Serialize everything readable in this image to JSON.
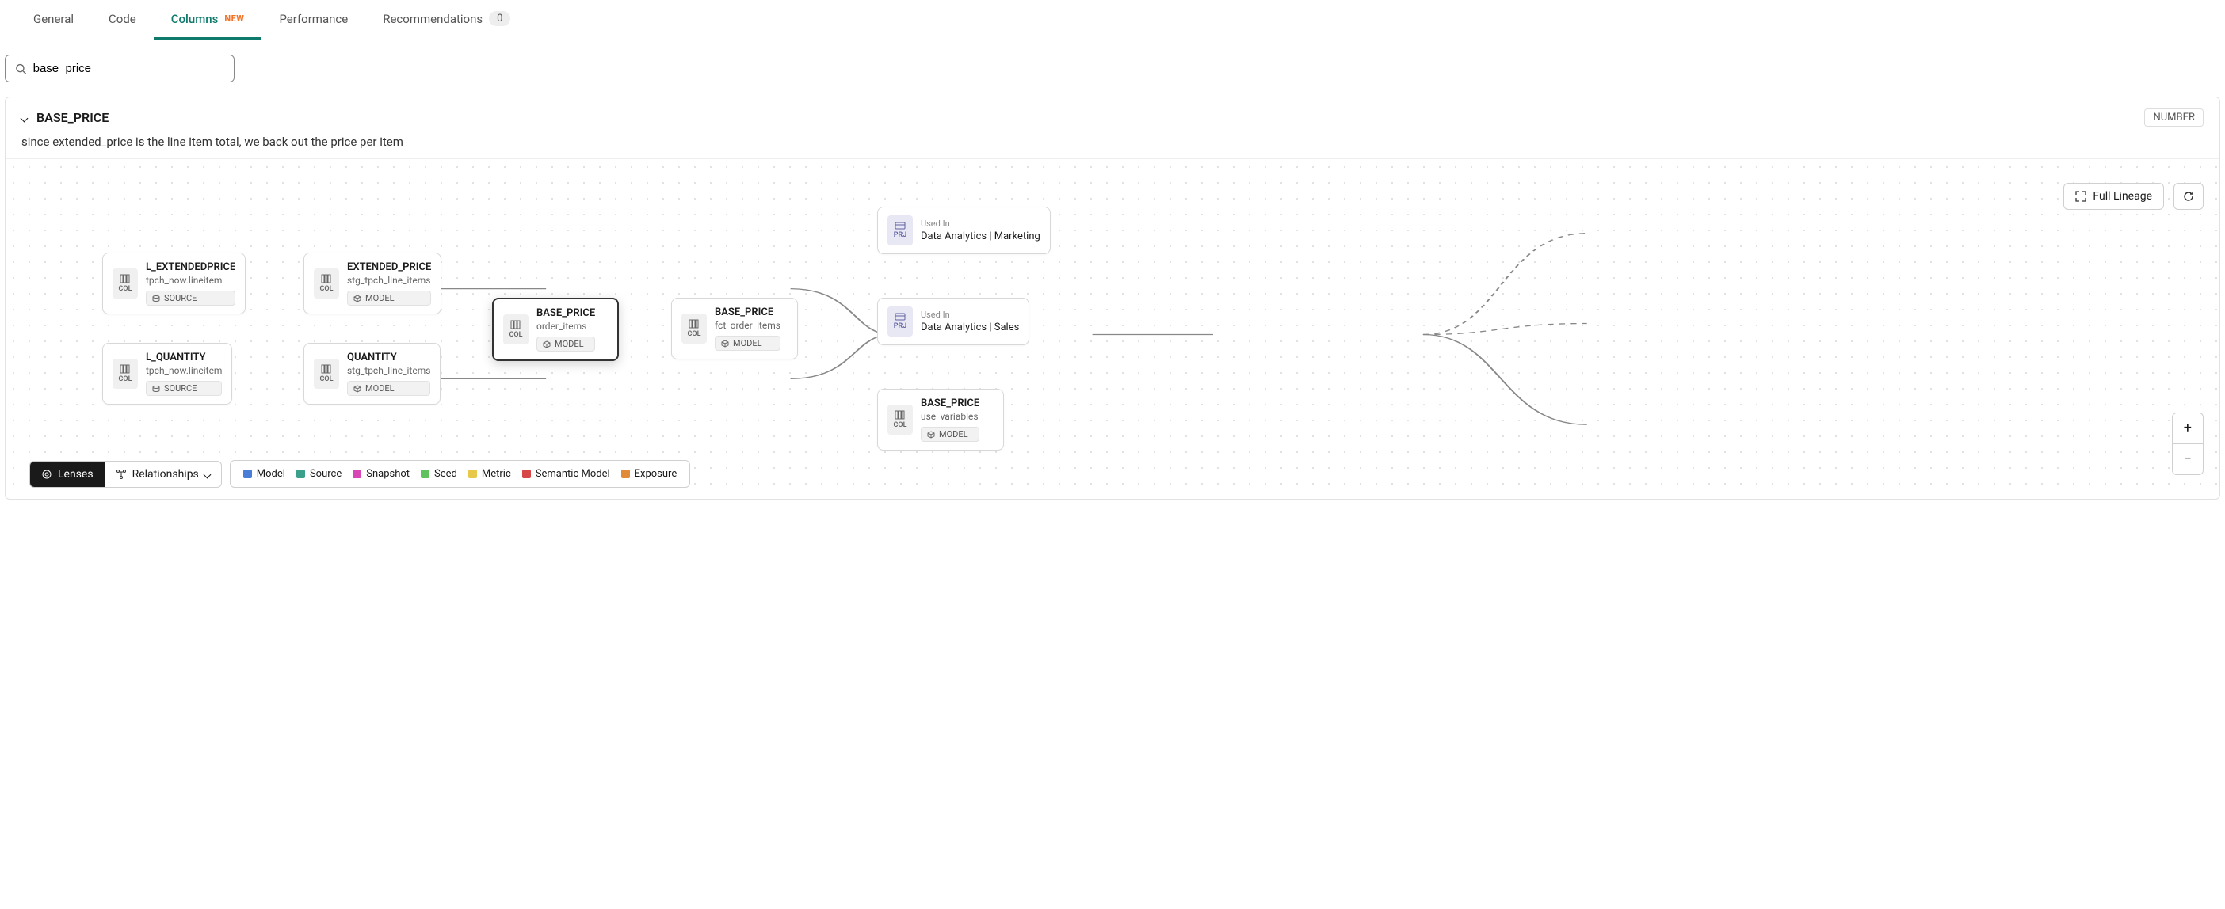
{
  "tabs": {
    "general": "General",
    "code": "Code",
    "columns": "Columns",
    "columns_badge": "NEW",
    "performance": "Performance",
    "recommendations": "Recommendations",
    "recommendations_count": "0"
  },
  "search": {
    "value": "base_price"
  },
  "column": {
    "name": "BASE_PRICE",
    "type": "NUMBER",
    "description": "since extended_price is the line item total, we back out the price per item"
  },
  "controls": {
    "full_lineage": "Full Lineage",
    "lenses": "Lenses",
    "relationships": "Relationships"
  },
  "legend": [
    {
      "label": "Model",
      "color": "#4a7dd8"
    },
    {
      "label": "Source",
      "color": "#3aa08c"
    },
    {
      "label": "Snapshot",
      "color": "#d847b5"
    },
    {
      "label": "Seed",
      "color": "#5fc25f"
    },
    {
      "label": "Metric",
      "color": "#e8c84a"
    },
    {
      "label": "Semantic Model",
      "color": "#d84747"
    },
    {
      "label": "Exposure",
      "color": "#e08a3a"
    }
  ],
  "nodes": {
    "lext": {
      "name": "L_EXTENDEDPRICE",
      "sub": "tpch_now.lineitem",
      "kind": "SOURCE",
      "icon": "COL"
    },
    "lqty": {
      "name": "L_QUANTITY",
      "sub": "tpch_now.lineitem",
      "kind": "SOURCE",
      "icon": "COL"
    },
    "ext": {
      "name": "EXTENDED_PRICE",
      "sub": "stg_tpch_line_items",
      "kind": "MODEL",
      "icon": "COL"
    },
    "qty": {
      "name": "QUANTITY",
      "sub": "stg_tpch_line_items",
      "kind": "MODEL",
      "icon": "COL"
    },
    "bp_oi": {
      "name": "BASE_PRICE",
      "sub": "order_items",
      "kind": "MODEL",
      "icon": "COL"
    },
    "bp_foi": {
      "name": "BASE_PRICE",
      "sub": "fct_order_items",
      "kind": "MODEL",
      "icon": "COL"
    },
    "prj_mkt": {
      "usedin": "Used In",
      "proj": "Data Analytics | Marketing",
      "icon": "PRJ"
    },
    "prj_sales": {
      "usedin": "Used In",
      "proj": "Data Analytics | Sales",
      "icon": "PRJ"
    },
    "bp_uv": {
      "name": "BASE_PRICE",
      "sub": "use_variables",
      "kind": "MODEL",
      "icon": "COL"
    }
  }
}
